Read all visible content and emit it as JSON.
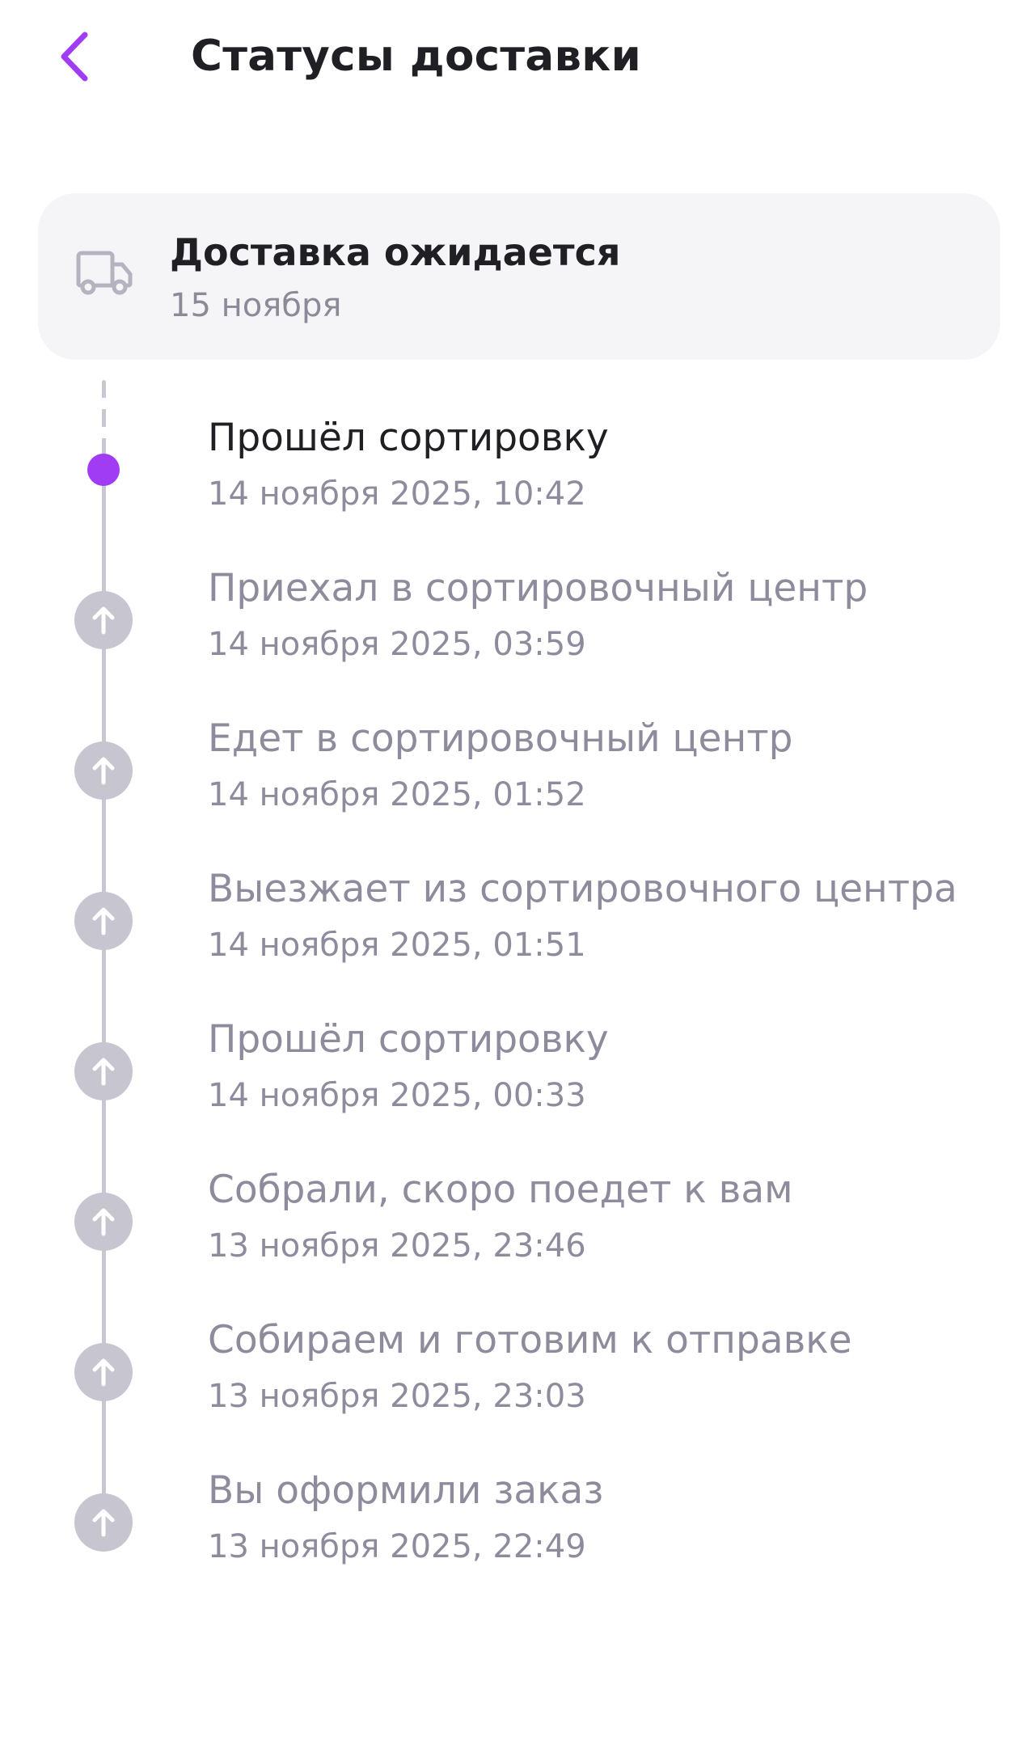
{
  "header": {
    "title": "Статусы доставки",
    "back_icon": "chevron-left-icon",
    "accent_color": "#a03df4"
  },
  "expected": {
    "icon": "truck-icon",
    "title": "Доставка ожидается",
    "date": "15 ноября"
  },
  "colors": {
    "current_marker": "#a03df4",
    "past_marker": "#c6c5d0",
    "line": "#c8c7d2",
    "muted_text": "#8e8c9c",
    "card_bg": "#f5f5f7"
  },
  "events": [
    {
      "title": "Прошёл сортировку",
      "time": "14 ноября 2025, 10:42",
      "current": true
    },
    {
      "title": "Приехал в сортировочный центр",
      "time": "14 ноября 2025, 03:59",
      "current": false,
      "icon": "arrow-up-icon"
    },
    {
      "title": "Едет в сортировочный центр",
      "time": "14 ноября 2025, 01:52",
      "current": false,
      "icon": "arrow-up-icon"
    },
    {
      "title": "Выезжает из сортировочного центра",
      "time": "14 ноября 2025, 01:51",
      "current": false,
      "icon": "arrow-up-icon"
    },
    {
      "title": "Прошёл сортировку",
      "time": "14 ноября 2025, 00:33",
      "current": false,
      "icon": "arrow-up-icon"
    },
    {
      "title": "Собрали, скоро поедет к вам",
      "time": "13 ноября 2025, 23:46",
      "current": false,
      "icon": "arrow-up-icon"
    },
    {
      "title": "Собираем и готовим к отправке",
      "time": "13 ноября 2025, 23:03",
      "current": false,
      "icon": "arrow-up-icon"
    },
    {
      "title": "Вы оформили заказ",
      "time": "13 ноября 2025, 22:49",
      "current": false,
      "icon": "arrow-up-icon"
    }
  ]
}
